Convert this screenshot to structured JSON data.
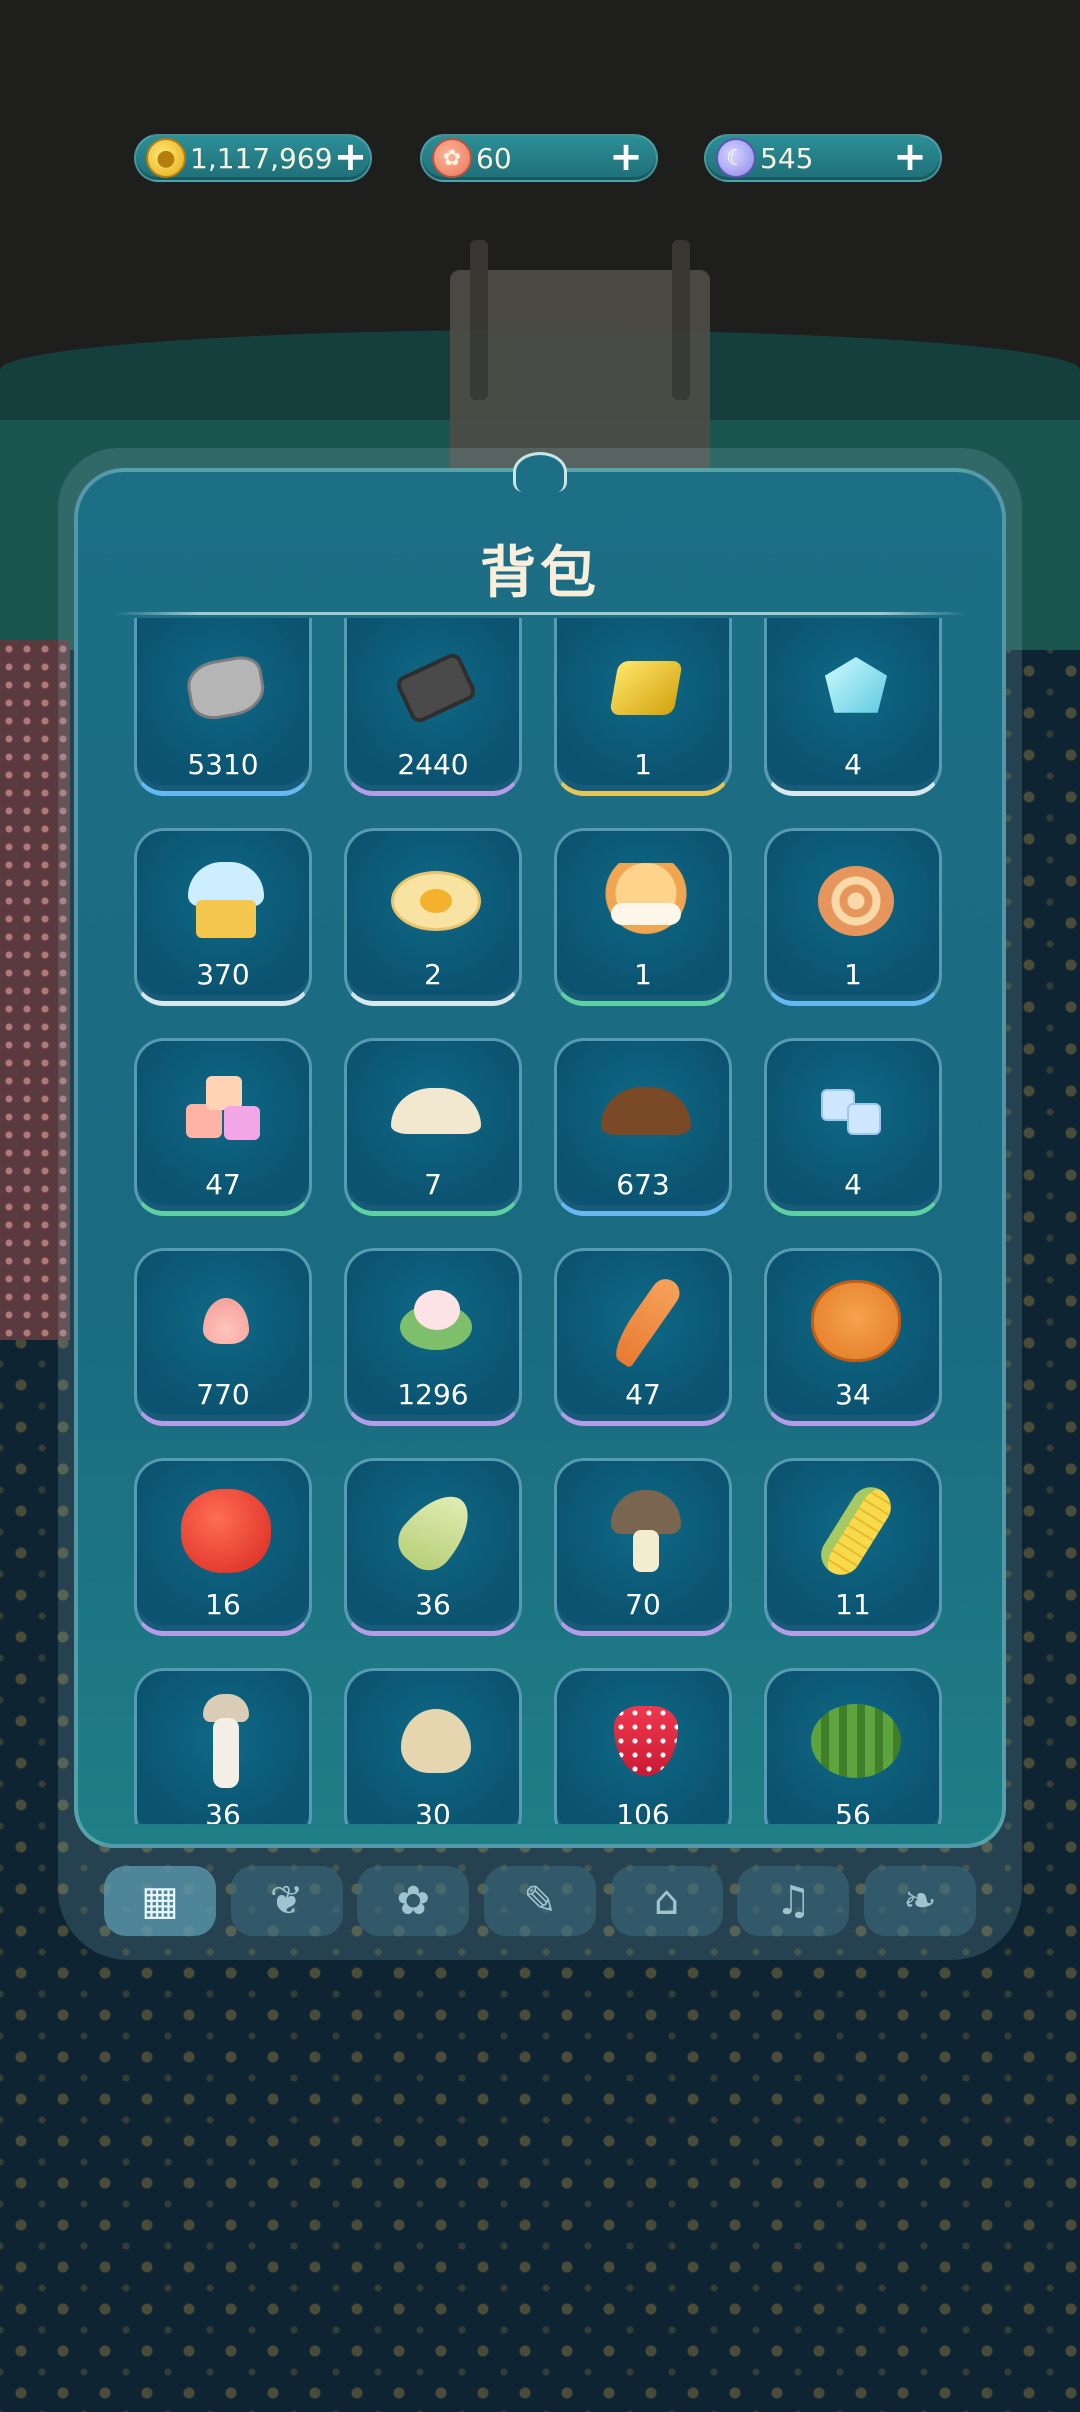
{
  "currencies": [
    {
      "name": "coins",
      "icon": "coin-icon",
      "value": "1,117,969",
      "plus": "+"
    },
    {
      "name": "hearts",
      "icon": "heart-face-icon",
      "value": "60",
      "plus": "+"
    },
    {
      "name": "moons",
      "icon": "moon-icon",
      "value": "545",
      "plus": "+"
    }
  ],
  "panel": {
    "title": "背包"
  },
  "items": [
    {
      "name": "stone",
      "art": "art-stone",
      "count": "5310",
      "tint": "blue"
    },
    {
      "name": "coal",
      "art": "art-coal",
      "count": "2440",
      "tint": "purple"
    },
    {
      "name": "gold-nugget",
      "art": "art-gold",
      "count": "1",
      "tint": "gold"
    },
    {
      "name": "crystal",
      "art": "art-gem",
      "count": "4",
      "tint": "white"
    },
    {
      "name": "frosted-cake",
      "art": "art-cake",
      "count": "370",
      "tint": "white"
    },
    {
      "name": "fried-egg",
      "art": "art-egg",
      "count": "2",
      "tint": "white"
    },
    {
      "name": "cream-puff",
      "art": "art-puff",
      "count": "1",
      "tint": "green"
    },
    {
      "name": "swiss-roll",
      "art": "art-roll",
      "count": "1",
      "tint": "blue"
    },
    {
      "name": "sugar-cubes",
      "art": "art-cubes",
      "count": "47",
      "tint": "green"
    },
    {
      "name": "flour",
      "art": "art-flour",
      "count": "7",
      "tint": "green"
    },
    {
      "name": "soil",
      "art": "art-soil",
      "count": "673",
      "tint": "blue"
    },
    {
      "name": "ice-cubes",
      "art": "art-ice",
      "count": "4",
      "tint": "green"
    },
    {
      "name": "cream",
      "art": "art-cream",
      "count": "770",
      "tint": "purple"
    },
    {
      "name": "cabbage",
      "art": "art-cabbage",
      "count": "1296",
      "tint": "purple"
    },
    {
      "name": "carrot",
      "art": "art-carrot",
      "count": "47",
      "tint": "purple"
    },
    {
      "name": "pumpkin",
      "art": "art-pumpkin",
      "count": "34",
      "tint": "purple"
    },
    {
      "name": "tomato",
      "art": "art-tomato",
      "count": "16",
      "tint": "purple"
    },
    {
      "name": "bamboo-shoot",
      "art": "art-shoot",
      "count": "36",
      "tint": "purple"
    },
    {
      "name": "mushroom",
      "art": "art-mushroom",
      "count": "70",
      "tint": "purple"
    },
    {
      "name": "corn",
      "art": "art-corn",
      "count": "11",
      "tint": "purple"
    },
    {
      "name": "king-oyster-mushroom",
      "art": "art-king",
      "count": "36",
      "tint": "purple"
    },
    {
      "name": "garlic",
      "art": "art-garlic",
      "count": "30",
      "tint": "purple"
    },
    {
      "name": "strawberry",
      "art": "art-berry",
      "count": "106",
      "tint": "purple"
    },
    {
      "name": "watermelon",
      "art": "art-melon",
      "count": "56",
      "tint": "purple"
    }
  ],
  "tabs": [
    {
      "name": "all",
      "icon": "grid-icon",
      "glyph": "▦",
      "active": true
    },
    {
      "name": "plants",
      "icon": "sprout-icon",
      "glyph": "❦",
      "active": false
    },
    {
      "name": "flowers",
      "icon": "flower-icon",
      "glyph": "✿",
      "active": false
    },
    {
      "name": "tools",
      "icon": "tools-icon",
      "glyph": "✎",
      "active": false
    },
    {
      "name": "clothing",
      "icon": "hanger-icon",
      "glyph": "⌂",
      "active": false
    },
    {
      "name": "music",
      "icon": "music-icon",
      "glyph": "♫",
      "active": false
    },
    {
      "name": "pets",
      "icon": "pet-icon",
      "glyph": "❧",
      "active": false
    }
  ]
}
